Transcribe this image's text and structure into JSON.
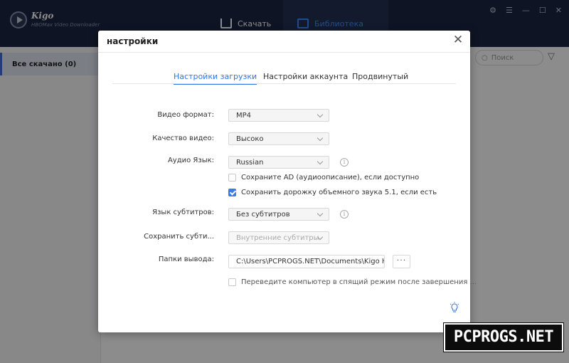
{
  "app": {
    "brand": "Kigo",
    "subtitle": "HBOMax Video Downloader"
  },
  "nav": {
    "download_label": "Скачать",
    "library_label": "Библиотека"
  },
  "sidebar": {
    "items": [
      {
        "label": "Все скачано (0)"
      }
    ]
  },
  "search": {
    "placeholder": "Поиск"
  },
  "dialog": {
    "title": "настройки",
    "tabs": [
      {
        "label": "Настройки загрузки",
        "active": true
      },
      {
        "label": "Настройки аккаунта",
        "active": false
      },
      {
        "label": "Продвинутый",
        "active": false
      }
    ],
    "fields": {
      "video_format": {
        "label": "Видео формат:",
        "value": "MP4"
      },
      "video_quality": {
        "label": "Качество видео:",
        "value": "Высоко"
      },
      "audio_language": {
        "label": "Аудио Язык:",
        "value": "Russian"
      },
      "save_ad": {
        "label": "Сохраните AD (аудиоописание), если доступно",
        "checked": false
      },
      "save_surround": {
        "label": "Сохранить дорожку объемного звука 5.1, если есть",
        "checked": true
      },
      "subtitle_language": {
        "label": "Язык субтитров:",
        "value": "Без субтитров"
      },
      "save_subtitles": {
        "label": "Сохранить субти...",
        "value": "Внутренние субтитры",
        "disabled": true
      },
      "output_folder": {
        "label": "Папки вывода:",
        "value": "C:\\Users\\PCPROGS.NET\\Documents\\Kigo H"
      },
      "sleep_after": {
        "label": "Переведите компьютер в спящий режим после завершения ...",
        "checked": false
      }
    },
    "browse_label": "···"
  },
  "watermark": {
    "text": "PCPROGS.NET"
  },
  "colors": {
    "accent": "#2f74e6",
    "titlebar": "#1b2541",
    "checkbox_checked": "#3d7ae6"
  }
}
